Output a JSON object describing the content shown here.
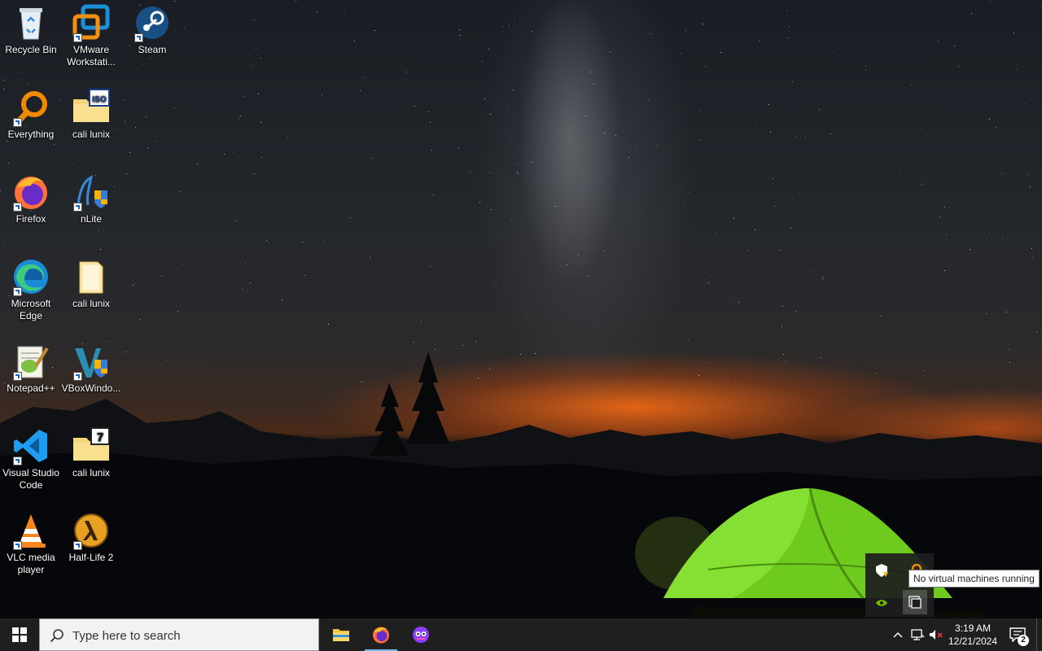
{
  "desktop": {
    "icons": [
      {
        "label": "Recycle Bin",
        "icon": "recycle-bin-icon",
        "shortcut": false
      },
      {
        "label": "VMware Workstati...",
        "icon": "vmware-icon",
        "shortcut": true
      },
      {
        "label": "Steam",
        "icon": "steam-icon",
        "shortcut": true
      },
      {
        "label": "Everything",
        "icon": "everything-search-icon",
        "shortcut": true
      },
      {
        "label": "cali lunix",
        "icon": "iso-folder-icon",
        "shortcut": false
      },
      {
        "label": "Firefox",
        "icon": "firefox-icon",
        "shortcut": true
      },
      {
        "label": "nLite",
        "icon": "nlite-icon",
        "shortcut": true
      },
      {
        "label": "Microsoft Edge",
        "icon": "edge-icon",
        "shortcut": true
      },
      {
        "label": "cali lunix",
        "icon": "document-folder-icon",
        "shortcut": false
      },
      {
        "label": "Notepad++",
        "icon": "notepadpp-icon",
        "shortcut": true
      },
      {
        "label": "VBoxWindo...",
        "icon": "vbox-icon",
        "shortcut": true
      },
      {
        "label": "Visual Studio Code",
        "icon": "vscode-icon",
        "shortcut": true
      },
      {
        "label": "cali lunix",
        "icon": "7z-folder-icon",
        "shortcut": false
      },
      {
        "label": "VLC media player",
        "icon": "vlc-icon",
        "shortcut": true
      },
      {
        "label": "Half-Life 2",
        "icon": "half-life-icon",
        "shortcut": true
      }
    ]
  },
  "tray_popup": {
    "tooltip": "No virtual machines running",
    "icons": [
      "security-shield-icon",
      "vmware-tray-icon",
      "nvidia-icon",
      "vm-window-icon"
    ]
  },
  "taskbar": {
    "start_icon": "windows-logo-icon",
    "search_placeholder": "Type here to search",
    "pinned": [
      {
        "name": "file-explorer",
        "icon": "folder-icon",
        "active": false
      },
      {
        "name": "firefox",
        "icon": "firefox-icon",
        "active": true
      },
      {
        "name": "app-purple",
        "icon": "purple-app-icon",
        "active": false
      }
    ],
    "system": {
      "time": "3:19 AM",
      "date": "12/21/2024",
      "notification_count": "2"
    }
  },
  "colors": {
    "taskbar_bg": "#1f1f1f",
    "accent": "#76b9ed",
    "tent_green": "#7fe22a"
  }
}
